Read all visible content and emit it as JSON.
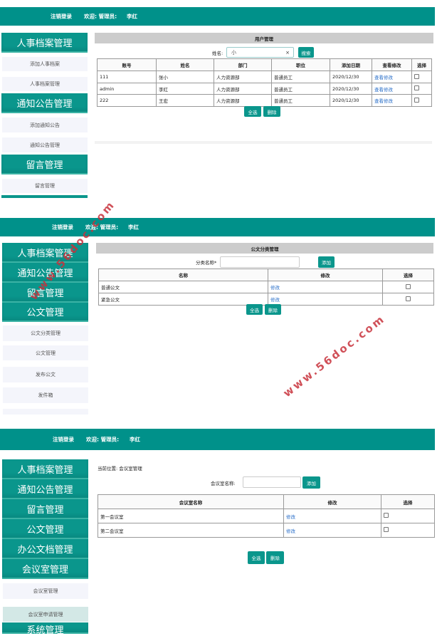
{
  "header": {
    "logout": "注销登录",
    "welcome": "欢迎: 管理员:",
    "user": "李红"
  },
  "watermark": "www.56doc.com",
  "panel1": {
    "sidebar": [
      {
        "type": "block",
        "label": "人事档案管理"
      },
      {
        "type": "item",
        "label": "添加人事档案"
      },
      {
        "type": "item",
        "label": "人事档案管理"
      },
      {
        "type": "block",
        "label": "通知公告管理"
      },
      {
        "type": "item",
        "label": "添加通知公告"
      },
      {
        "type": "item",
        "label": "通知公告管理"
      },
      {
        "type": "block",
        "label": "留言管理"
      },
      {
        "type": "item",
        "label": "留言管理"
      }
    ],
    "title": "用户管理",
    "search_label": "姓名:",
    "search_value": "小",
    "clear": "×",
    "search_button": "搜索",
    "columns": [
      "账号",
      "姓名",
      "部门",
      "职位",
      "添加日期",
      "查看修改",
      "选择"
    ],
    "rows": [
      [
        "111",
        "张小",
        "人力资源部",
        "普通员工",
        "2020/12/30",
        "查看修改"
      ],
      [
        "admin",
        "李红",
        "人力资源部",
        "普通员工",
        "2020/12/30",
        "查看修改"
      ],
      [
        "222",
        "王宏",
        "人力资源部",
        "普通员工",
        "2020/12/30",
        "查看修改"
      ]
    ],
    "select_all": "全选",
    "delete": "删除"
  },
  "panel2": {
    "sidebar": [
      {
        "type": "block",
        "label": "人事档案管理"
      },
      {
        "type": "block",
        "label": "通知公告管理"
      },
      {
        "type": "block",
        "label": "留言管理"
      },
      {
        "type": "block",
        "label": "公文管理"
      },
      {
        "type": "item",
        "label": "公文分类管理"
      },
      {
        "type": "item",
        "label": "公文管理"
      },
      {
        "type": "item",
        "label": "发布公文"
      },
      {
        "type": "item",
        "label": "发件箱"
      }
    ],
    "title": "公文分类管理",
    "input_label": "分类名称*",
    "input_value": "",
    "add_button": "添加",
    "columns": [
      "名称",
      "修改",
      "选择"
    ],
    "rows": [
      [
        "普通公文",
        "修改"
      ],
      [
        "紧急公文",
        "修改"
      ]
    ],
    "select_all": "全选",
    "delete": "删除"
  },
  "panel3": {
    "sidebar": [
      {
        "type": "block",
        "label": "人事档案管理"
      },
      {
        "type": "block",
        "label": "通知公告管理"
      },
      {
        "type": "block",
        "label": "留言管理"
      },
      {
        "type": "block",
        "label": "公文管理"
      },
      {
        "type": "block",
        "label": "办公文档管理"
      },
      {
        "type": "block",
        "label": "会议室管理"
      },
      {
        "type": "item",
        "label": "会议室管理"
      },
      {
        "type": "item",
        "label": "会议室申请管理"
      },
      {
        "type": "block",
        "label": "系统管理"
      }
    ],
    "breadcrumb": "当前位置: 会议室管理",
    "input_label": "会议室名称:",
    "input_value": "",
    "add_button": "添加",
    "columns": [
      "会议室名称",
      "修改",
      "选择"
    ],
    "rows": [
      [
        "第一会议室",
        "修改"
      ],
      [
        "第二会议室",
        "修改"
      ]
    ],
    "select_all": "全选",
    "delete": "删除"
  }
}
